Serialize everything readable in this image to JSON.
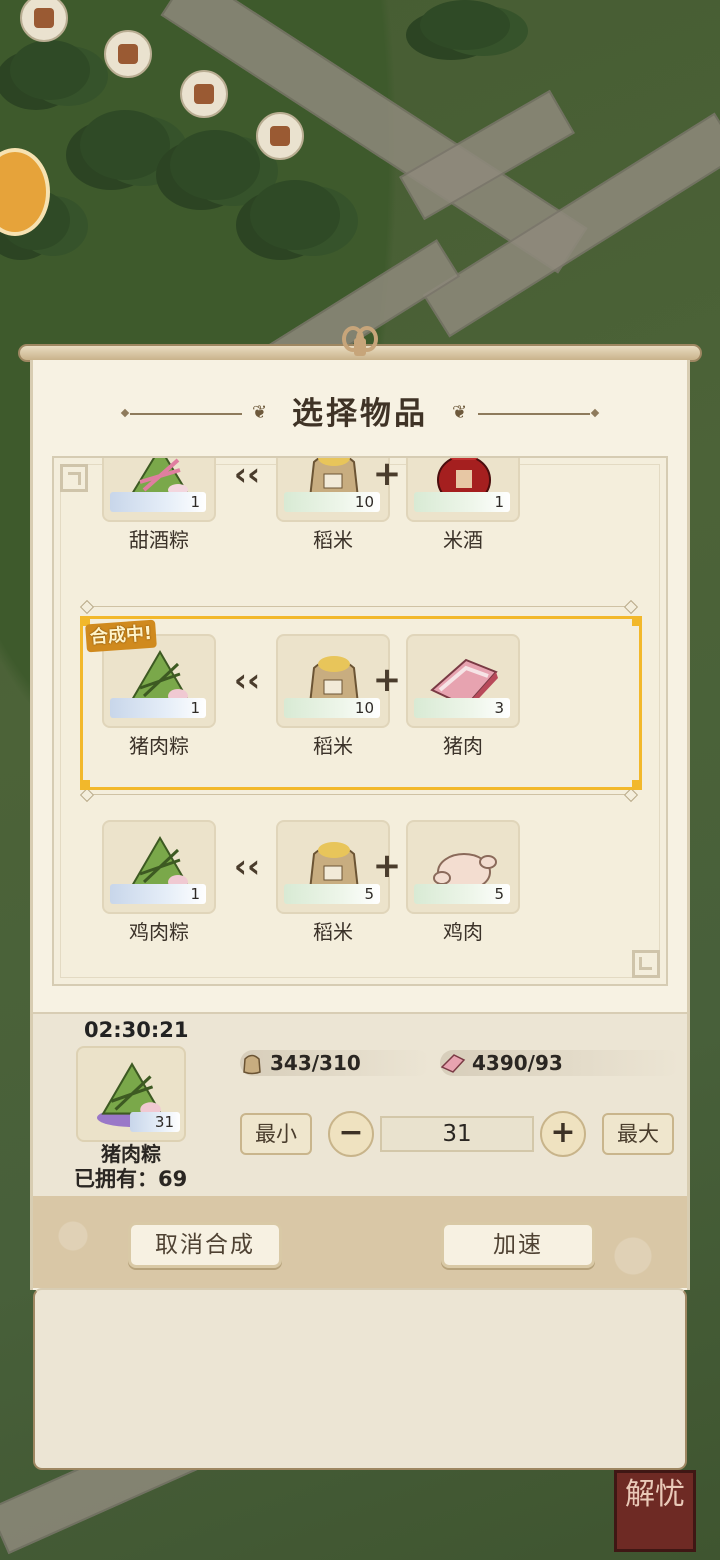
{
  "dialog": {
    "title": "选择物品",
    "crafting_badge": "合成中!"
  },
  "recipes": [
    {
      "product": {
        "name": "甜酒粽",
        "qty": "1",
        "icon": "zongzi-sweet-wine-icon"
      },
      "ingredients": [
        {
          "name": "稻米",
          "qty": "10",
          "icon": "rice-sack-icon"
        },
        {
          "name": "米酒",
          "qty": "1",
          "icon": "wine-jar-icon"
        }
      ]
    },
    {
      "product": {
        "name": "猪肉粽",
        "qty": "1",
        "icon": "zongzi-pork-icon"
      },
      "ingredients": [
        {
          "name": "稻米",
          "qty": "10",
          "icon": "rice-sack-icon"
        },
        {
          "name": "猪肉",
          "qty": "3",
          "icon": "pork-icon"
        }
      ],
      "selected": true
    },
    {
      "product": {
        "name": "鸡肉粽",
        "qty": "1",
        "icon": "zongzi-chicken-icon"
      },
      "ingredients": [
        {
          "name": "稻米",
          "qty": "5",
          "icon": "rice-sack-icon"
        },
        {
          "name": "鸡肉",
          "qty": "5",
          "icon": "chicken-icon"
        }
      ]
    }
  ],
  "crafting": {
    "timer": "02:30:21",
    "product_name": "猪肉粽",
    "product_qty": "31",
    "owned_text": "已拥有：69",
    "resources": [
      {
        "icon": "rice-sack-icon",
        "text": "343/310"
      },
      {
        "icon": "pork-icon",
        "text": "4390/93"
      }
    ],
    "min_label": "最小",
    "max_label": "最大",
    "count": "31",
    "minus_symbol": "−",
    "plus_symbol": "+"
  },
  "actions": {
    "cancel_label": "取消合成",
    "speed_label": "加速"
  },
  "corner_badge": {
    "text": "解忧"
  },
  "colors": {
    "highlight": "#f2b82b",
    "paper": "#f7f2e3",
    "footer": "#d9c7a6"
  }
}
